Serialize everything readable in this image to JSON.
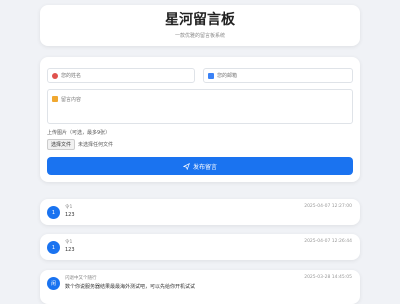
{
  "header": {
    "title": "星河留言板",
    "subtitle": "一款优雅的留言板系统"
  },
  "form": {
    "name_placeholder": "您的姓名",
    "email_placeholder": "您的邮箱",
    "content_placeholder": "留言内容",
    "upload_label": "上传图片（可选，最多9张）",
    "file_button": "选择文件",
    "file_status": "未选择任何文件",
    "submit_label": "发布留言"
  },
  "messages": [
    {
      "avatar": "1",
      "author": "令1",
      "text": "123",
      "time": "2025-04-07 12:27:00"
    },
    {
      "avatar": "1",
      "author": "令1",
      "text": "123",
      "time": "2025-04-07 12:26:44"
    },
    {
      "avatar": "闲",
      "author": "闪退中又个随行",
      "text": "数个你说服务器结果最最海外测试吧，可以先给你开机试试",
      "time": "2025-03-28 14:45:05"
    }
  ],
  "colors": {
    "accent": "#1a73f0",
    "background": "#f0f2f6"
  }
}
